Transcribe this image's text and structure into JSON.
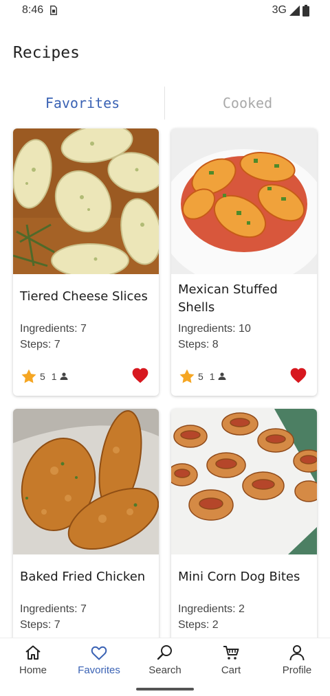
{
  "status_bar": {
    "time": "8:46",
    "network": "3G",
    "icons": [
      "sim-icon",
      "signal-icon",
      "battery-icon"
    ]
  },
  "header": {
    "title": "Recipes"
  },
  "tabs": [
    {
      "label": "Favorites",
      "active": true
    },
    {
      "label": "Cooked",
      "active": false
    }
  ],
  "recipes": [
    {
      "title": "Tiered Cheese Slices",
      "ingredients": "Ingredients: 7",
      "steps": "Steps: 7",
      "rating": "5",
      "cooks": "1",
      "favorite": true
    },
    {
      "title": "Mexican Stuffed Shells",
      "ingredients": "Ingredients: 10",
      "steps": "Steps: 8",
      "rating": "5",
      "cooks": "1",
      "favorite": true
    },
    {
      "title": "Baked Fried Chicken",
      "ingredients": "Ingredients: 7",
      "steps": "Steps: 7"
    },
    {
      "title": "Mini Corn Dog Bites",
      "ingredients": "Ingredients: 2",
      "steps": "Steps: 2"
    }
  ],
  "bottom_nav": [
    {
      "label": "Home",
      "icon": "home-icon"
    },
    {
      "label": "Favorites",
      "icon": "heart-icon",
      "active": true
    },
    {
      "label": "Search",
      "icon": "search-icon"
    },
    {
      "label": "Cart",
      "icon": "cart-icon"
    },
    {
      "label": "Profile",
      "icon": "profile-icon"
    }
  ],
  "colors": {
    "accent": "#3a62b4",
    "inactive_tab": "#a9a9a9",
    "star": "#f5a623",
    "heart": "#d7181f"
  }
}
